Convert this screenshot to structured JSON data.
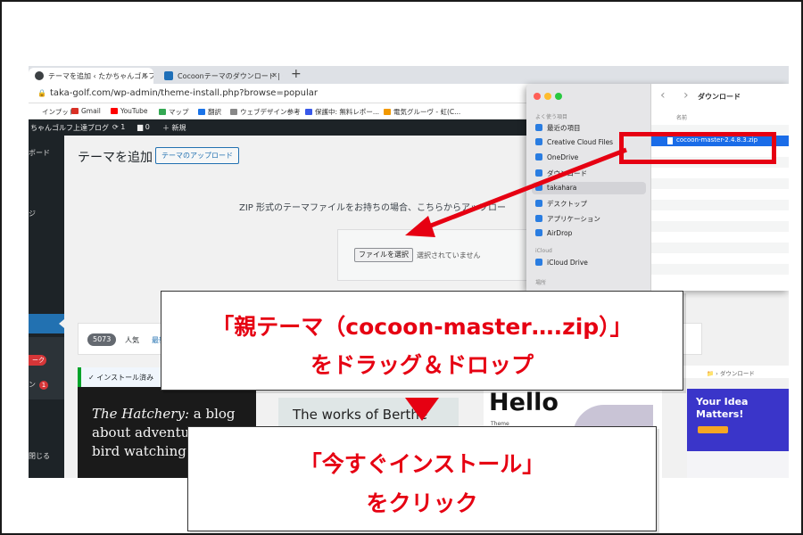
{
  "browser": {
    "tabs": [
      {
        "title": "テーマを追加 ‹ たかちゃんゴルフ上"
      },
      {
        "title": "Cocoonテーマのダウンロード | C"
      }
    ],
    "new_tab": "+",
    "url": "taka-golf.com/wp-admin/theme-install.php?browse=popular",
    "bookmarks": [
      {
        "label": "インプット",
        "color": "#888888"
      },
      {
        "label": "Gmail",
        "color": "#d93025"
      },
      {
        "label": "YouTube",
        "color": "#ff0000"
      },
      {
        "label": "マップ",
        "color": "#34a853"
      },
      {
        "label": "翻訳",
        "color": "#1a73e8"
      },
      {
        "label": "ウェブデザイン参考",
        "color": "#888888"
      },
      {
        "label": "保護中: 無料レポー...",
        "color": "#3858e9"
      },
      {
        "label": "電気グルーヴ - 虹(C...",
        "color": "#f29900"
      }
    ]
  },
  "wp": {
    "admin_bar": {
      "site": "ちゃんゴルフ上達ブログ",
      "updates": "1",
      "comments": "0",
      "new": "新規"
    },
    "sidebar": {
      "dashboard": "ボード",
      "item2": "ジ",
      "badge_label": "ーク",
      "item_n": "ン",
      "count": "1",
      "close": "閉じる"
    },
    "page_title": "テーマを追加",
    "upload_button": "テーマのアップロード",
    "zip_instruction": "ZIP 形式のテーマファイルをお持ちの場合、こちらからアップロー",
    "file_button": "ファイルを選択",
    "file_none": "選択されていません",
    "theme_count": "5073",
    "filter_popular": "人気",
    "filter_latest": "最新",
    "installed_label": "インストール済み",
    "theme1_text_italic": "The Hatchery:",
    "theme1_text": " a blog about adventures in bird watching.",
    "theme2_text": "The works of Berthe",
    "theme3_title": "Hello",
    "theme3_sub": "Theme",
    "theme4_text": "Your Idea Matters!"
  },
  "finder": {
    "favorites_label": "よく使う項目",
    "items": [
      {
        "label": "最近の項目"
      },
      {
        "label": "Creative Cloud Files"
      },
      {
        "label": "OneDrive"
      },
      {
        "label": "ダウンロード"
      },
      {
        "label": "takahara"
      },
      {
        "label": "デスクトップ"
      },
      {
        "label": "アプリケーション"
      },
      {
        "label": "AirDrop"
      }
    ],
    "icloud_label": "iCloud",
    "icloud_drive": "iCloud Drive",
    "location_label": "場所",
    "nav": "‹ ›",
    "title": "ダウンロード",
    "column_name": "名前",
    "selected_file": "cocoon-master-2.4.8.3.zip",
    "path": "ダウンロード"
  },
  "callouts": {
    "drag_line1": "「親テーマ（cocoon-master….zip）」",
    "drag_line2": "をドラッグ＆ドロップ",
    "install_line1": "「今すぐインストール」",
    "install_line2": "をクリック"
  },
  "colors": {
    "highlight": "#e60012",
    "wp_admin": "#1d2327",
    "wp_blue": "#2271b1"
  }
}
